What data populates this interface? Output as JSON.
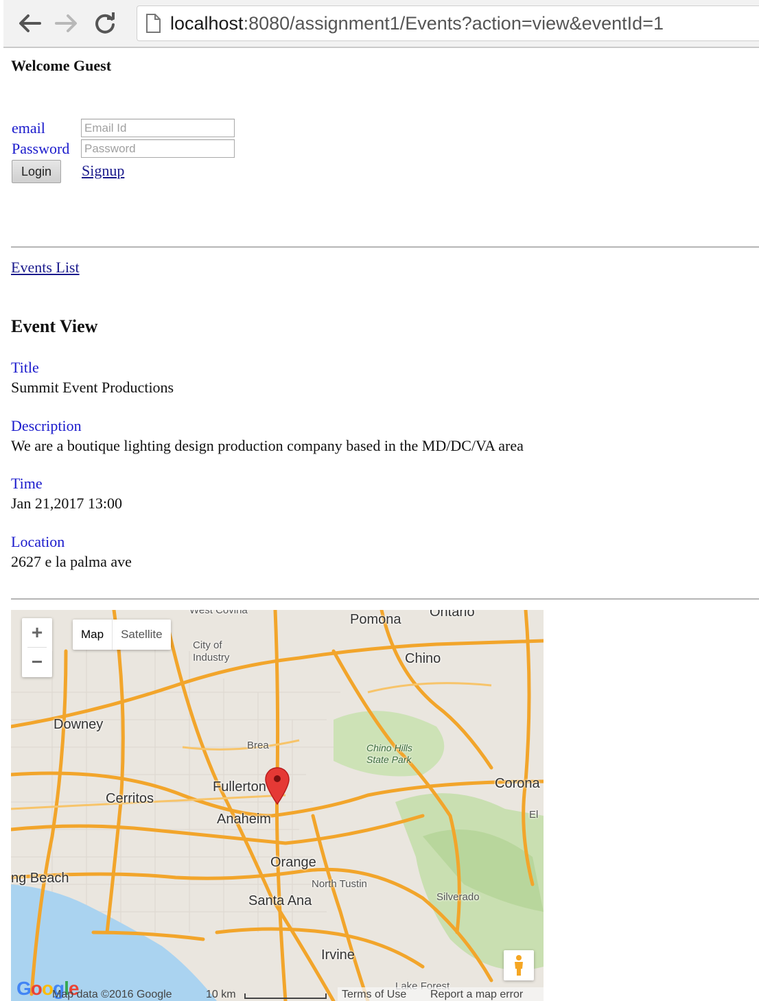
{
  "browser": {
    "url_host": "localhost",
    "url_path": ":8080/assignment1/Events?action=view&eventId=1",
    "back_icon": "back-arrow-icon",
    "forward_icon": "forward-arrow-icon",
    "reload_icon": "reload-icon",
    "page_icon": "page-icon"
  },
  "header": {
    "welcome": "Welcome Guest"
  },
  "login": {
    "email_label": "email",
    "email_placeholder": "Email Id",
    "password_label": "Password",
    "password_placeholder": "Password",
    "login_button": "Login",
    "signup_link": "Signup"
  },
  "nav": {
    "events_list_link": "Events List"
  },
  "event": {
    "heading": "Event View",
    "title_label": "Title",
    "title_value": "Summit Event Productions",
    "description_label": "Description",
    "description_value": "We are a boutique lighting design production company based in the MD/DC/VA area",
    "time_label": "Time",
    "time_value": "Jan 21,2017 13:00",
    "location_label": "Location",
    "location_value": "2627 e la palma ave"
  },
  "map": {
    "zoom_in": "+",
    "zoom_out": "−",
    "type_map": "Map",
    "type_satellite": "Satellite",
    "labels": {
      "pomona": "Pomona",
      "ontario": "Ontario",
      "chino": "Chino",
      "city_of_industry": "City of\nIndustry",
      "downey": "Downey",
      "brea": "Brea",
      "chino_hills": "Chino Hills\nState Park",
      "fullerton": "Fullerton",
      "corona": "Corona",
      "cerritos": "Cerritos",
      "anaheim": "Anaheim",
      "el": "El",
      "orange": "Orange",
      "long_beach": "ng Beach",
      "north_tustin": "North Tustin",
      "silverado": "Silverado",
      "santa_ana": "Santa Ana",
      "irvine": "Irvine",
      "lake_forest": "Lake Forest",
      "west_covina": "West Covina"
    },
    "footer": {
      "google": "Google",
      "map_data": "Map data ©2016 Google",
      "scale": "10 km",
      "terms": "Terms of Use",
      "report": "Report a map error"
    },
    "pegman_icon": "pegman-icon",
    "marker_icon": "map-marker-icon",
    "colors": {
      "road": "#f2a52b",
      "land": "#eae6df",
      "park": "#c9dfb1",
      "water": "#aad3f0",
      "marker": "#e53935"
    }
  }
}
